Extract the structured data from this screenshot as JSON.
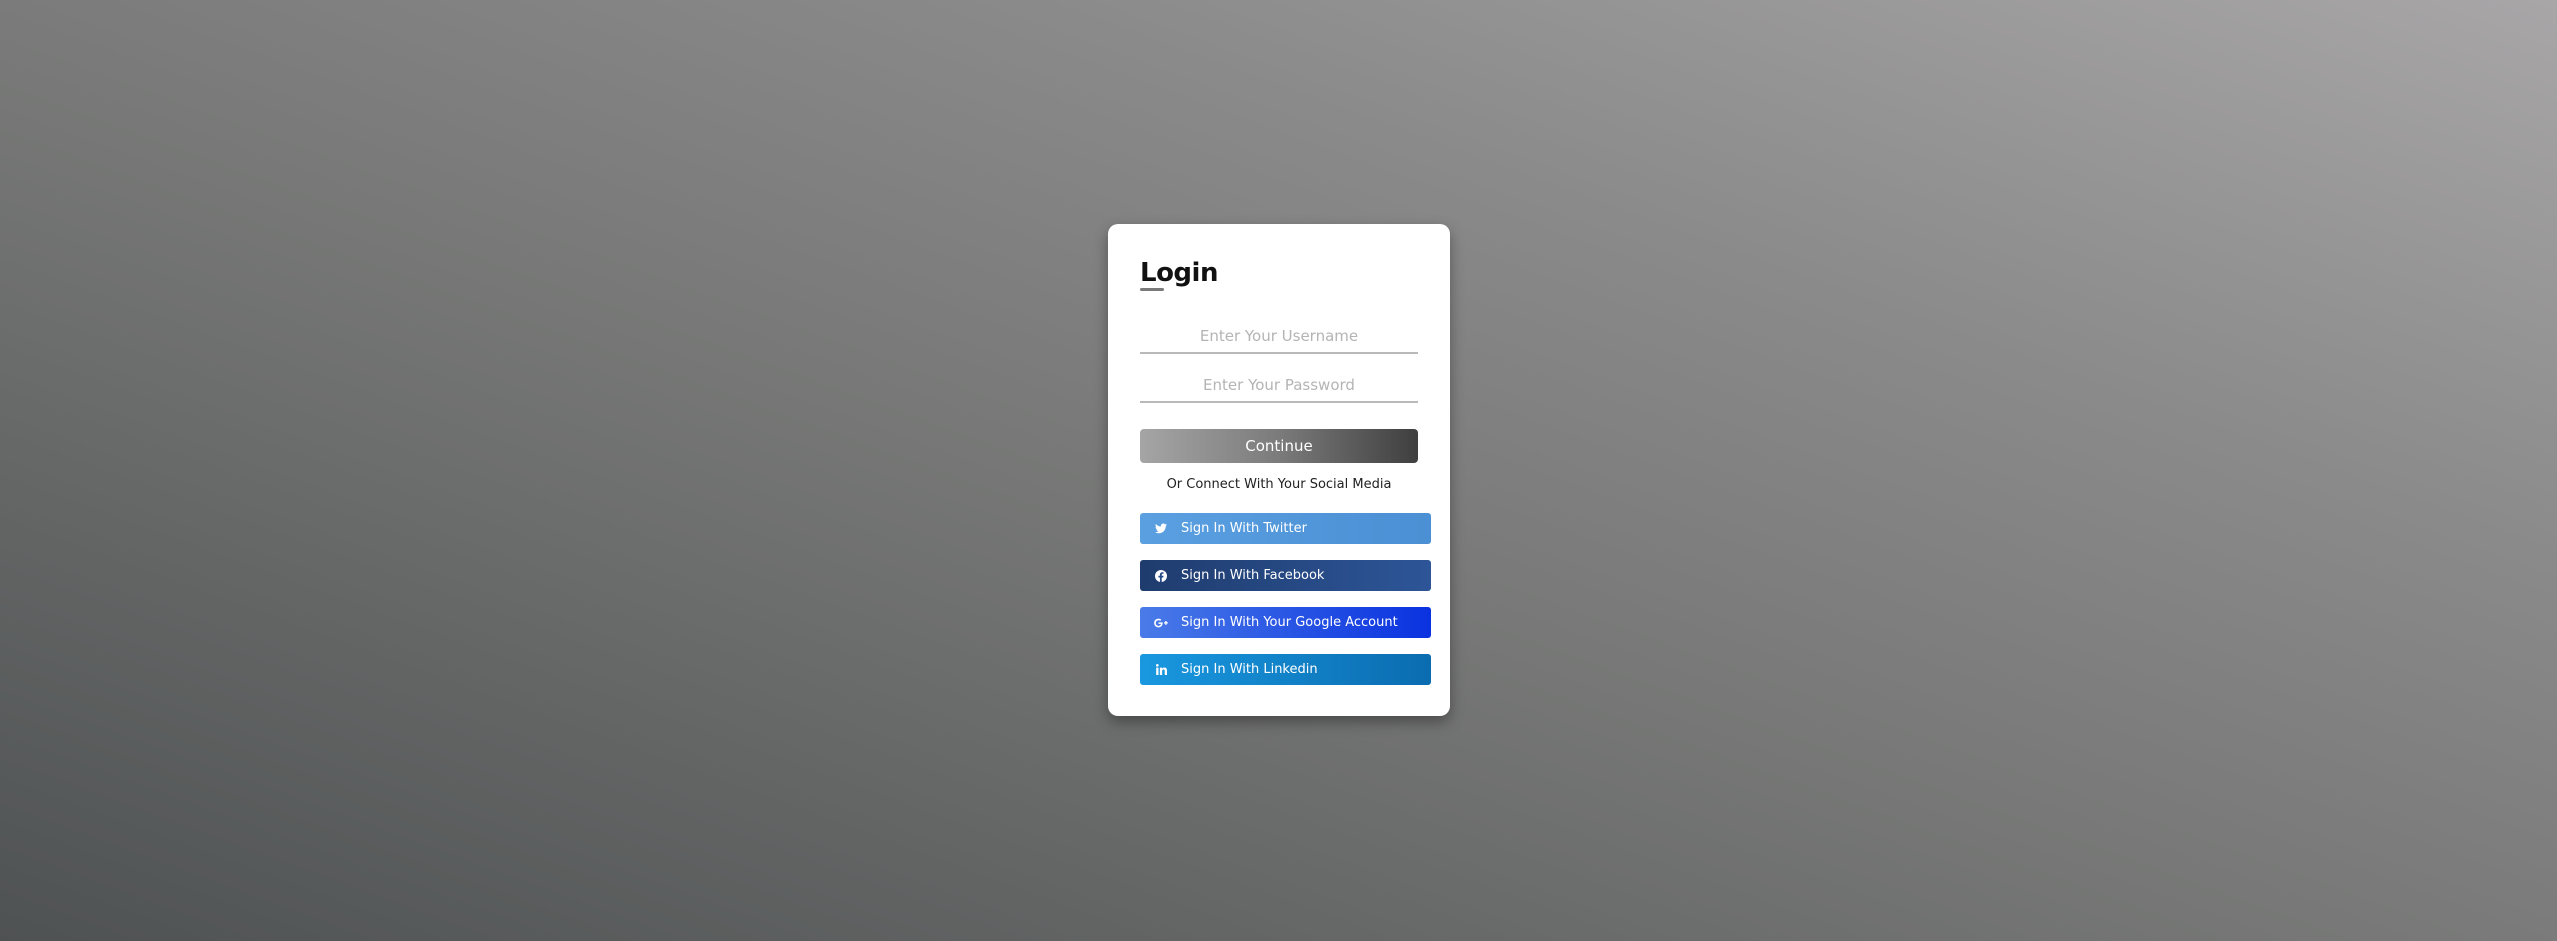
{
  "login": {
    "title": "Login",
    "username": {
      "value": "",
      "placeholder": "Enter Your Username"
    },
    "password": {
      "value": "",
      "placeholder": "Enter Your Password"
    },
    "continue_label": "Continue",
    "social_heading": "Or Connect With Your Social Media",
    "social": [
      {
        "label": "Sign In With Twitter",
        "icon": "twitter-icon",
        "color": "#4f95d8"
      },
      {
        "label": "Sign In With Facebook",
        "icon": "facebook-icon",
        "color": "#264a85"
      },
      {
        "label": "Sign In With Your Google Account",
        "icon": "google-plus-icon",
        "color": "#1f4fe6"
      },
      {
        "label": "Sign In With Linkedin",
        "icon": "linkedin-icon",
        "color": "#1180c8"
      }
    ]
  },
  "colors": {
    "background_light": "#a8a6a7",
    "background_dark": "#4f5253",
    "card": "#ffffff",
    "continue_start": "#a5a5a5",
    "continue_end": "#3f3f3f"
  }
}
